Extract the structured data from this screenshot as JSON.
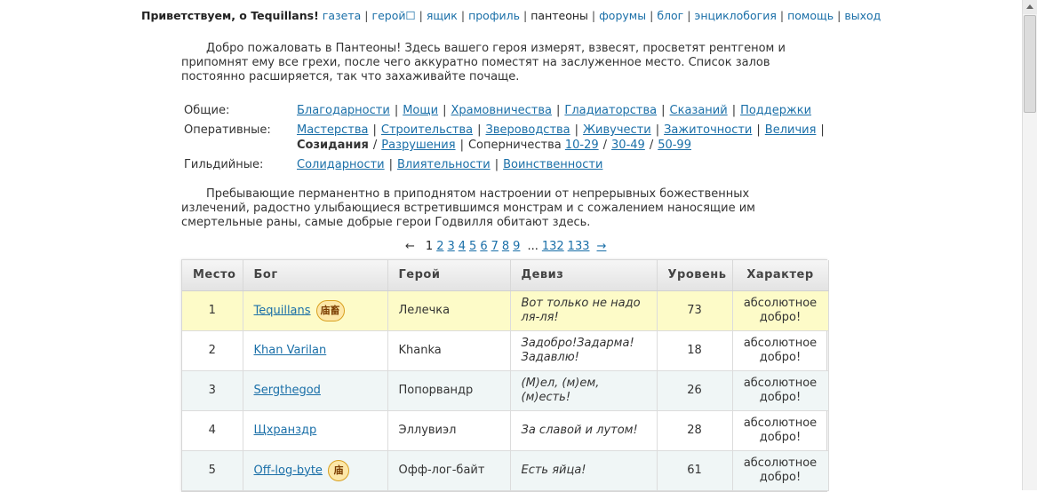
{
  "topnav": {
    "greeting": "Приветствуем, о Tequillans!",
    "items": [
      {
        "label": "газета",
        "link": true
      },
      {
        "label": "герой☐",
        "link": true
      },
      {
        "label": "ящик",
        "link": true
      },
      {
        "label": "профиль",
        "link": true
      },
      {
        "label": "пантеоны",
        "link": false
      },
      {
        "label": "форумы",
        "link": true
      },
      {
        "label": "блог",
        "link": true
      },
      {
        "label": "энциклобогия",
        "link": true
      },
      {
        "label": "помощь",
        "link": true
      },
      {
        "label": "выход",
        "link": true
      }
    ]
  },
  "intro": "Добро пожаловать в Пантеоны! Здесь вашего героя измерят, взвесят, просветят рентгеном и припомнят ему все грехи, после чего аккуратно поместят на заслуженное место. Список залов постоянно расширяется, так что захаживайте почаще.",
  "halls": {
    "general": {
      "label": "Общие:",
      "items": [
        "Благодарности",
        "Мощи",
        "Храмовничества",
        "Гладиаторства",
        "Сказаний",
        "Поддержки"
      ]
    },
    "operative": {
      "label": "Оперативные:",
      "items": [
        "Мастерства",
        "Строительства",
        "Звероводства",
        "Живучести",
        "Зажиточности",
        "Величия"
      ],
      "creation": "Созидания",
      "destruction": "Разрушения",
      "rivalry": "Соперничества",
      "rivalry_ranges": [
        "10-29",
        "30-49",
        "50-99"
      ]
    },
    "guild": {
      "label": "Гильдийные:",
      "items": [
        "Солидарности",
        "Влиятельности",
        "Воинственности"
      ]
    }
  },
  "description": "Пребывающие перманентно в приподнятом настроении от непрерывных божественных излечений, радостно улыбающиеся встретившимся монстрам и с сожалением наносящие им смертельные раны, самые добрые герои Годвилля обитают здесь.",
  "pager": {
    "prev": "←",
    "current": "1",
    "pages": [
      "2",
      "3",
      "4",
      "5",
      "6",
      "7",
      "8",
      "9"
    ],
    "ellipsis": "...",
    "last_pages": [
      "132",
      "133"
    ],
    "next": "→"
  },
  "table": {
    "headers": [
      "Место",
      "Бог",
      "Герой",
      "Девиз",
      "Уровень",
      "Характер"
    ],
    "rows": [
      {
        "place": "1",
        "god": "Tequillans",
        "badge": "庙畜",
        "hero": "Лелечка",
        "motto": "Вот только не надо ля-ля!",
        "level": "73",
        "character": "абсолютное добро!"
      },
      {
        "place": "2",
        "god": "Khan Varilan",
        "badge": "",
        "hero": "Khanka",
        "motto": "Задобро!Задарма! Задавлю!",
        "level": "18",
        "character": "абсолютное добро!"
      },
      {
        "place": "3",
        "god": "Sergthegod",
        "badge": "",
        "hero": "Попорвандр",
        "motto": "(М)ел, (м)ем, (м)есть!",
        "level": "26",
        "character": "абсолютное добро!"
      },
      {
        "place": "4",
        "god": "Щхранздр",
        "badge": "",
        "hero": "Эллувиэл",
        "motto": "За славой и лутом!",
        "level": "28",
        "character": "абсолютное добро!"
      },
      {
        "place": "5",
        "god": "Off-log-byte",
        "badge": "庙",
        "hero": "Офф-лог-байт",
        "motto": "Есть яйца!",
        "level": "61",
        "character": "абсолютное добро!"
      }
    ]
  }
}
